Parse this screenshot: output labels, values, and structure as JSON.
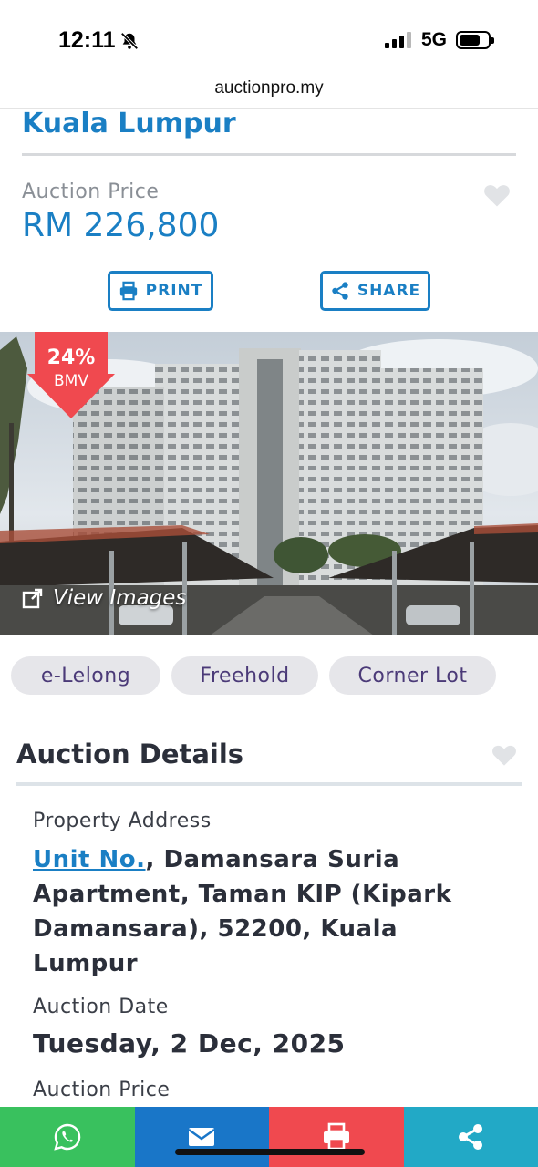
{
  "status_bar": {
    "time": "12:11",
    "network": "5G"
  },
  "browser": {
    "url": "auctionpro.my"
  },
  "header": {
    "location": "Kuala Lumpur",
    "price_label": "Auction Price",
    "price_value": "RM 226,800"
  },
  "actions": {
    "print_label": "PRINT",
    "share_label": "SHARE"
  },
  "photo": {
    "bmv_percent": "24%",
    "bmv_label": "BMV",
    "view_images_label": "View Images"
  },
  "tags": [
    "e-Lelong",
    "Freehold",
    "Corner Lot"
  ],
  "details": {
    "title": "Auction Details",
    "address_label": "Property Address",
    "address_link": "Unit No.",
    "address_rest": ", Damansara Suria Apartment, Taman KIP (Kipark Damansara), 52200, Kuala Lumpur",
    "date_label": "Auction Date",
    "date_value": "Tuesday, 2 Dec, 2025",
    "price_label": "Auction Price"
  },
  "bottom_bar": [
    "whatsapp-icon",
    "mail-icon",
    "printer-icon",
    "share-icon"
  ],
  "colors": {
    "brand_blue": "#1a7fc4",
    "whatsapp": "#39c15e",
    "email": "#1976c8",
    "print": "#f0494f",
    "share": "#22a9c6",
    "badge": "#f0494f"
  }
}
